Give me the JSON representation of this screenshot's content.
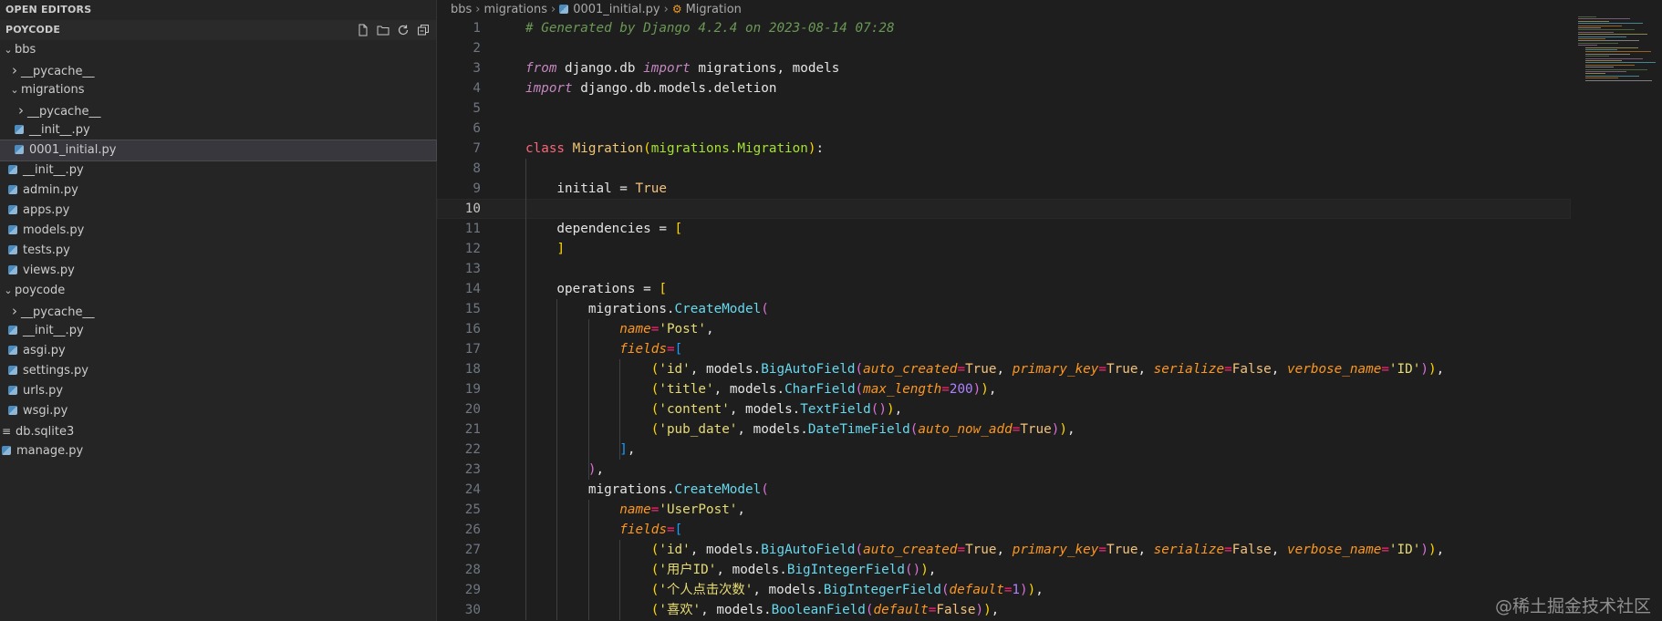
{
  "sidebar": {
    "open_editors": "OPEN EDITORS",
    "project": "POYCODE",
    "actions": [
      "new-file-icon",
      "new-folder-icon",
      "refresh-icon",
      "collapse-all-icon"
    ],
    "tree": [
      {
        "label": "bbs",
        "type": "folder",
        "open": true,
        "level": 0
      },
      {
        "label": "__pycache__",
        "type": "folder",
        "open": false,
        "level": 1
      },
      {
        "label": "migrations",
        "type": "folder",
        "open": true,
        "level": 1
      },
      {
        "label": "__pycache__",
        "type": "folder",
        "open": false,
        "level": 2
      },
      {
        "label": "__init__.py",
        "type": "py",
        "level": 2
      },
      {
        "label": "0001_initial.py",
        "type": "py",
        "level": 2,
        "selected": true
      },
      {
        "label": "__init__.py",
        "type": "py",
        "level": 1
      },
      {
        "label": "admin.py",
        "type": "py",
        "level": 1
      },
      {
        "label": "apps.py",
        "type": "py",
        "level": 1
      },
      {
        "label": "models.py",
        "type": "py",
        "level": 1
      },
      {
        "label": "tests.py",
        "type": "py",
        "level": 1
      },
      {
        "label": "views.py",
        "type": "py",
        "level": 1
      },
      {
        "label": "poycode",
        "type": "folder",
        "open": true,
        "level": 0
      },
      {
        "label": "__pycache__",
        "type": "folder",
        "open": false,
        "level": 1
      },
      {
        "label": "__init__.py",
        "type": "py",
        "level": 1
      },
      {
        "label": "asgi.py",
        "type": "py",
        "level": 1
      },
      {
        "label": "settings.py",
        "type": "py",
        "level": 1
      },
      {
        "label": "urls.py",
        "type": "py",
        "level": 1
      },
      {
        "label": "wsgi.py",
        "type": "py",
        "level": 1
      },
      {
        "label": "db.sqlite3",
        "type": "db",
        "level": 0
      },
      {
        "label": "manage.py",
        "type": "py",
        "level": 0
      }
    ]
  },
  "breadcrumb": {
    "parts": [
      "bbs",
      "migrations"
    ],
    "file": "0001_initial.py",
    "symbol": "Migration"
  },
  "editor": {
    "current_line": 10,
    "lines": [
      {
        "n": "1",
        "tokens": [
          [
            "t-com",
            "# Generated by Django 4.2.4 on 2023-08-14 07:28"
          ]
        ]
      },
      {
        "n": "2",
        "tokens": []
      },
      {
        "n": "3",
        "tokens": [
          [
            "t-kw",
            "from"
          ],
          [
            "t-plain",
            " django.db "
          ],
          [
            "t-kw",
            "import"
          ],
          [
            "t-plain",
            " migrations, models"
          ]
        ]
      },
      {
        "n": "4",
        "tokens": [
          [
            "t-kw",
            "import"
          ],
          [
            "t-plain",
            " django.db.models.deletion"
          ]
        ]
      },
      {
        "n": "5",
        "tokens": []
      },
      {
        "n": "6",
        "tokens": []
      },
      {
        "n": "7",
        "tokens": [
          [
            "t-def",
            "class"
          ],
          [
            "t-plain",
            " "
          ],
          [
            "t-cls",
            "Migration"
          ],
          [
            "t-brk",
            "("
          ],
          [
            "t-base",
            "migrations.Migration"
          ],
          [
            "t-brk",
            ")"
          ],
          [
            "t-plain",
            ":"
          ]
        ]
      },
      {
        "n": "8",
        "tokens": []
      },
      {
        "n": "9",
        "tokens": [
          [
            "t-plain",
            "    initial = "
          ],
          [
            "t-const",
            "True"
          ]
        ]
      },
      {
        "n": "10",
        "tokens": []
      },
      {
        "n": "11",
        "tokens": [
          [
            "t-plain",
            "    dependencies = "
          ],
          [
            "t-brk",
            "["
          ]
        ]
      },
      {
        "n": "12",
        "tokens": [
          [
            "t-plain",
            "    "
          ],
          [
            "t-brk",
            "]"
          ]
        ]
      },
      {
        "n": "13",
        "tokens": []
      },
      {
        "n": "14",
        "tokens": [
          [
            "t-plain",
            "    operations = "
          ],
          [
            "t-brk",
            "["
          ]
        ]
      },
      {
        "n": "15",
        "tokens": [
          [
            "t-plain",
            "        migrations."
          ],
          [
            "t-fn",
            "CreateModel"
          ],
          [
            "t-brk2",
            "("
          ]
        ]
      },
      {
        "n": "16",
        "tokens": [
          [
            "t-plain",
            "            "
          ],
          [
            "t-kwarg",
            "name"
          ],
          [
            "t-op",
            "="
          ],
          [
            "t-str",
            "'Post'"
          ],
          [
            "t-plain",
            ","
          ]
        ]
      },
      {
        "n": "17",
        "tokens": [
          [
            "t-plain",
            "            "
          ],
          [
            "t-kwarg",
            "fields"
          ],
          [
            "t-op",
            "="
          ],
          [
            "t-brk3",
            "["
          ]
        ]
      },
      {
        "n": "18",
        "tokens": [
          [
            "t-plain",
            "                "
          ],
          [
            "t-brk",
            "("
          ],
          [
            "t-str",
            "'id'"
          ],
          [
            "t-plain",
            ", models."
          ],
          [
            "t-fn",
            "BigAutoField"
          ],
          [
            "t-brk2",
            "("
          ],
          [
            "t-kwarg",
            "auto_created"
          ],
          [
            "t-op",
            "="
          ],
          [
            "t-const",
            "True"
          ],
          [
            "t-plain",
            ", "
          ],
          [
            "t-kwarg",
            "primary_key"
          ],
          [
            "t-op",
            "="
          ],
          [
            "t-const",
            "True"
          ],
          [
            "t-plain",
            ", "
          ],
          [
            "t-kwarg",
            "serialize"
          ],
          [
            "t-op",
            "="
          ],
          [
            "t-const",
            "False"
          ],
          [
            "t-plain",
            ", "
          ],
          [
            "t-kwarg",
            "verbose_name"
          ],
          [
            "t-op",
            "="
          ],
          [
            "t-str",
            "'ID'"
          ],
          [
            "t-brk2",
            ")"
          ],
          [
            "t-brk",
            ")"
          ],
          [
            "t-plain",
            ","
          ]
        ]
      },
      {
        "n": "19",
        "tokens": [
          [
            "t-plain",
            "                "
          ],
          [
            "t-brk",
            "("
          ],
          [
            "t-str",
            "'title'"
          ],
          [
            "t-plain",
            ", models."
          ],
          [
            "t-fn",
            "CharField"
          ],
          [
            "t-brk2",
            "("
          ],
          [
            "t-kwarg",
            "max_length"
          ],
          [
            "t-op",
            "="
          ],
          [
            "t-num",
            "200"
          ],
          [
            "t-brk2",
            ")"
          ],
          [
            "t-brk",
            ")"
          ],
          [
            "t-plain",
            ","
          ]
        ]
      },
      {
        "n": "20",
        "tokens": [
          [
            "t-plain",
            "                "
          ],
          [
            "t-brk",
            "("
          ],
          [
            "t-str",
            "'content'"
          ],
          [
            "t-plain",
            ", models."
          ],
          [
            "t-fn",
            "TextField"
          ],
          [
            "t-brk2",
            "()"
          ],
          [
            "t-brk",
            ")"
          ],
          [
            "t-plain",
            ","
          ]
        ]
      },
      {
        "n": "21",
        "tokens": [
          [
            "t-plain",
            "                "
          ],
          [
            "t-brk",
            "("
          ],
          [
            "t-str",
            "'pub_date'"
          ],
          [
            "t-plain",
            ", models."
          ],
          [
            "t-fn",
            "DateTimeField"
          ],
          [
            "t-brk2",
            "("
          ],
          [
            "t-kwarg",
            "auto_now_add"
          ],
          [
            "t-op",
            "="
          ],
          [
            "t-const",
            "True"
          ],
          [
            "t-brk2",
            ")"
          ],
          [
            "t-brk",
            ")"
          ],
          [
            "t-plain",
            ","
          ]
        ]
      },
      {
        "n": "22",
        "tokens": [
          [
            "t-plain",
            "            "
          ],
          [
            "t-brk3",
            "]"
          ],
          [
            "t-plain",
            ","
          ]
        ]
      },
      {
        "n": "23",
        "tokens": [
          [
            "t-plain",
            "        "
          ],
          [
            "t-brk2",
            ")"
          ],
          [
            "t-plain",
            ","
          ]
        ]
      },
      {
        "n": "24",
        "tokens": [
          [
            "t-plain",
            "        migrations."
          ],
          [
            "t-fn",
            "CreateModel"
          ],
          [
            "t-brk2",
            "("
          ]
        ]
      },
      {
        "n": "25",
        "tokens": [
          [
            "t-plain",
            "            "
          ],
          [
            "t-kwarg",
            "name"
          ],
          [
            "t-op",
            "="
          ],
          [
            "t-str",
            "'UserPost'"
          ],
          [
            "t-plain",
            ","
          ]
        ]
      },
      {
        "n": "26",
        "tokens": [
          [
            "t-plain",
            "            "
          ],
          [
            "t-kwarg",
            "fields"
          ],
          [
            "t-op",
            "="
          ],
          [
            "t-brk3",
            "["
          ]
        ]
      },
      {
        "n": "27",
        "tokens": [
          [
            "t-plain",
            "                "
          ],
          [
            "t-brk",
            "("
          ],
          [
            "t-str",
            "'id'"
          ],
          [
            "t-plain",
            ", models."
          ],
          [
            "t-fn",
            "BigAutoField"
          ],
          [
            "t-brk2",
            "("
          ],
          [
            "t-kwarg",
            "auto_created"
          ],
          [
            "t-op",
            "="
          ],
          [
            "t-const",
            "True"
          ],
          [
            "t-plain",
            ", "
          ],
          [
            "t-kwarg",
            "primary_key"
          ],
          [
            "t-op",
            "="
          ],
          [
            "t-const",
            "True"
          ],
          [
            "t-plain",
            ", "
          ],
          [
            "t-kwarg",
            "serialize"
          ],
          [
            "t-op",
            "="
          ],
          [
            "t-const",
            "False"
          ],
          [
            "t-plain",
            ", "
          ],
          [
            "t-kwarg",
            "verbose_name"
          ],
          [
            "t-op",
            "="
          ],
          [
            "t-str",
            "'ID'"
          ],
          [
            "t-brk2",
            ")"
          ],
          [
            "t-brk",
            ")"
          ],
          [
            "t-plain",
            ","
          ]
        ]
      },
      {
        "n": "28",
        "tokens": [
          [
            "t-plain",
            "                "
          ],
          [
            "t-brk",
            "("
          ],
          [
            "t-str",
            "'用户ID'"
          ],
          [
            "t-plain",
            ", models."
          ],
          [
            "t-fn",
            "BigIntegerField"
          ],
          [
            "t-brk2",
            "()"
          ],
          [
            "t-brk",
            ")"
          ],
          [
            "t-plain",
            ","
          ]
        ]
      },
      {
        "n": "29",
        "tokens": [
          [
            "t-plain",
            "                "
          ],
          [
            "t-brk",
            "("
          ],
          [
            "t-str",
            "'个人点击次数'"
          ],
          [
            "t-plain",
            ", models."
          ],
          [
            "t-fn",
            "BigIntegerField"
          ],
          [
            "t-brk2",
            "("
          ],
          [
            "t-kwarg",
            "default"
          ],
          [
            "t-op",
            "="
          ],
          [
            "t-num",
            "1"
          ],
          [
            "t-brk2",
            ")"
          ],
          [
            "t-brk",
            ")"
          ],
          [
            "t-plain",
            ","
          ]
        ]
      },
      {
        "n": "30",
        "tokens": [
          [
            "t-plain",
            "                "
          ],
          [
            "t-brk",
            "("
          ],
          [
            "t-str",
            "'喜欢'"
          ],
          [
            "t-plain",
            ", models."
          ],
          [
            "t-fn",
            "BooleanField"
          ],
          [
            "t-brk2",
            "("
          ],
          [
            "t-kwarg",
            "default"
          ],
          [
            "t-op",
            "="
          ],
          [
            "t-const",
            "False"
          ],
          [
            "t-brk2",
            ")"
          ],
          [
            "t-brk",
            ")"
          ],
          [
            "t-plain",
            ","
          ]
        ]
      }
    ]
  },
  "watermark": "@稀土掘金技术社区"
}
